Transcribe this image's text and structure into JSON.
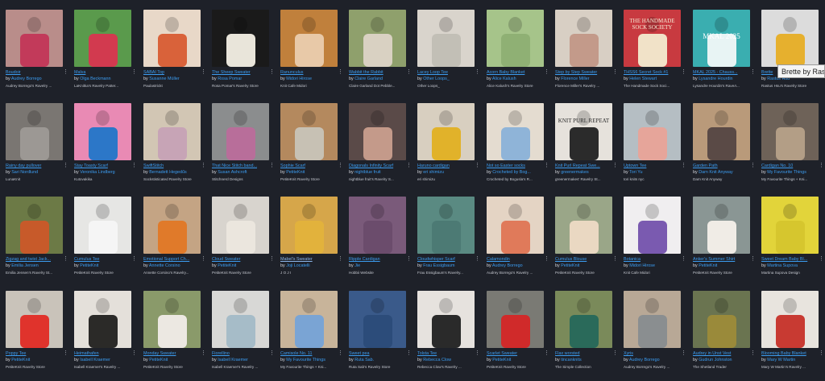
{
  "more_glyph": "⋮",
  "by_prefix": "by",
  "tooltip": "Brette by Ras",
  "thumb_text": {
    "sock": "THE HANDMADE SOCK SOCIETY",
    "mkal": "MKAL 2025",
    "knitpurl": "KNIT PURL REPEAT"
  },
  "rows": [
    [
      {
        "title": "Boudoir",
        "designer": "Audrey Borrego",
        "source": "Audrey Borrego's Ravelry ...",
        "bg": "#b98d8a",
        "fg": "#c23a5a"
      },
      {
        "title": "Malva",
        "designer": "Olga Beckmann",
        "source": "LaKnitka's Ravelry Patter...",
        "bg": "#5a9a4c",
        "fg": "#d23a4f"
      },
      {
        "title": "SABAI Top",
        "designer": "Susanne Müller",
        "source": "Paulastrickt",
        "bg": "#e8d8c8",
        "fg": "#d9623a"
      },
      {
        "title": "The Sheep Sweater",
        "designer": "Rosa Pomar",
        "source": "Rosa Pomar's Ravelry Store",
        "bg": "#1a1a1a",
        "fg": "#e9e5da"
      },
      {
        "title": "Ranunculus",
        "designer": "Midori Hirose",
        "source": "Knit Cafe Midori",
        "bg": "#c0803c",
        "fg": "#e8c9a8"
      },
      {
        "title": "Wabbit the Rabbit",
        "designer": "Claire Garland",
        "source": "Claire Garland Dot Pebble...",
        "bg": "#8fa06c",
        "fg": "#d9d1c2"
      },
      {
        "title": "Lacey Loop Tee",
        "designer": "Other Loops_",
        "source": "Other Loops_",
        "bg": "#d9d4cc",
        "fg": "#c2bfb6"
      },
      {
        "title": "Acorn Baby Blanket",
        "designer": "Alice Kalush",
        "source": "Alice Kalush's Ravelry Store",
        "bg": "#a6c48a",
        "fg": "#8fb074"
      },
      {
        "title": "Step by Step Sweater",
        "designer": "Florence Miller",
        "source": "Florence Miller's Ravelry ...",
        "bg": "#d8cfc4",
        "fg": "#c39a8a"
      },
      {
        "title": "THSS6 Secret Sock #1",
        "designer": "Helen Stewart",
        "source": "The Handmade Sock Soci...",
        "bg": "#c83a40",
        "fg": "#f1e2c8"
      },
      {
        "title": "MKAL 2025 - Chauss...",
        "designer": "Lysandre Hourdin",
        "source": "Lysandre Hourdin's Raveл...",
        "bg": "#3aaeb0",
        "fg": "#e8f4f4"
      },
      {
        "title": "Brette",
        "designer": "Rastus Hsu",
        "source": "Rastus Hsu's Ravelry Store",
        "bg": "#dcdcdc",
        "fg": "#e6b02e"
      }
    ],
    [
      {
        "title": "Rainy day pullover",
        "designer": "Sari Nordlund",
        "source": "LunaKnit",
        "bg": "#7a7672",
        "fg": "#9c9894"
      },
      {
        "title": "Stay Toasty Scarf",
        "designer": "Veronika Lindberg",
        "source": "Kutovakika",
        "bg": "#e98ab4",
        "fg": "#2c77c8"
      },
      {
        "title": "SwiftStitch",
        "designer": "Bernadett Hegedűs",
        "source": "Sockstisticated Ravelry Store",
        "bg": "#d2c6b4",
        "fg": "#c7a4b6"
      },
      {
        "title": "That Nice Stitch band...",
        "designer": "Susan Ashcroft",
        "source": "Stitchnerd Designs",
        "bg": "#8b8d8e",
        "fg": "#b86e9a"
      },
      {
        "title": "Sophie Scarf",
        "designer": "PetiteKnit",
        "source": "PetiteKnit Ravelry Store",
        "bg": "#b4895e",
        "fg": "#c7c1b4"
      },
      {
        "title": "Diagonals Infinity Scarf",
        "designer": "nightblue fruit",
        "source": "nightblue fruit's Ravelry S...",
        "bg": "#5a4a48",
        "fg": "#c49a8a"
      },
      {
        "title": "Haruno cardigan",
        "designer": "eri shimizu",
        "source": "eri shimizu",
        "bg": "#d8cfc0",
        "fg": "#e1b22a"
      },
      {
        "title": "Not so Easter socks",
        "designer": "Crocheted by Bog...",
        "source": "Crocheted by Boguslа's R...",
        "bg": "#e4dcd0",
        "fg": "#8fb4d8"
      },
      {
        "title": "Knit Purl Repeat Swe...",
        "designer": "greenermakes",
        "source": "greenermakes' Ravelry St...",
        "bg": "#e6e2dc",
        "fg": "#2b2b2b"
      },
      {
        "title": "Uptown Tee",
        "designer": "Tori Yu",
        "source": "tori knits nyc",
        "bg": "#b5bec3",
        "fg": "#e6a59a"
      },
      {
        "title": "Garden Path",
        "designer": "Darn Knit Anyway",
        "source": "Darn Knit Anyway",
        "bg": "#b99a7a",
        "fg": "#5a4a46"
      },
      {
        "title": "Cardigan No. 10",
        "designer": "My Favourite Things",
        "source": "My Favourite Things + Kni...",
        "bg": "#6e6258",
        "fg": "#b39e86"
      }
    ],
    [
      {
        "title": "Zigzag and twist Jack...",
        "designer": "Emilia Jensen",
        "source": "Emilia Jensen's Ravelry St...",
        "bg": "#6c7a46",
        "fg": "#c75a2a"
      },
      {
        "title": "Cumulus Tee",
        "designer": "PetiteKnit",
        "source": "PetiteKnit Ravelry Store",
        "bg": "#e6e6e4",
        "fg": "#f5f5f5"
      },
      {
        "title": "Emotional Support Ch...",
        "designer": "Annette Corsino",
        "source": "Annette Corsino's Ravelry...",
        "bg": "#c4a484",
        "fg": "#e07a2a"
      },
      {
        "title": "Cloud Sweater",
        "designer": "PetiteKnit",
        "source": "PetiteKnit Ravelry Store",
        "bg": "#d8d4ce",
        "fg": "#ebe6de"
      },
      {
        "title": "Mabel's Sweater",
        "designer": "Joji Locatelli",
        "source": "J O J I",
        "bg": "#d6a64a",
        "fg": "#e2b23c",
        "visited": true
      },
      {
        "title": "Ripple Cardigan",
        "designer": "Jie",
        "source": "Hobbii Website",
        "bg": "#7a5a7a",
        "fg": "#6b4c6c"
      },
      {
        "title": "Cloudwhisper Scarf",
        "designer": "Frau Essigbaum",
        "source": "Frau Essigbaum's Ravelry...",
        "bg": "#5a8a82",
        "fg": "#4c7a74"
      },
      {
        "title": "Calamondin",
        "designer": "Audrey Borrego",
        "source": "Audrey Borrego's Ravelry ...",
        "bg": "#e4d4c4",
        "fg": "#e07a5a"
      },
      {
        "title": "Cumulus Blouse",
        "designer": "PetiteKnit",
        "source": "PetiteKnit Ravelry Store",
        "bg": "#9aa688",
        "fg": "#ead8c2"
      },
      {
        "title": "Botanica",
        "designer": "Midori Hirose",
        "source": "Knit Cafe Midori",
        "bg": "#f0eef0",
        "fg": "#7a5ab0"
      },
      {
        "title": "Anker's Summer Shirt",
        "designer": "PetiteKnit",
        "source": "PetiteKnit Ravelry Store",
        "bg": "#8a9694",
        "fg": "#f0ece6"
      },
      {
        "title": "Sweet Dream Baby Bl...",
        "designer": "Martina Supova",
        "source": "Martina Supova Design",
        "bg": "#e2d43a",
        "fg": "#d6c62e"
      }
    ],
    [
      {
        "title": "Poppy Tee",
        "designer": "PetiteKnit",
        "source": "PetiteKnit Ravelry Store",
        "bg": "#c9c3ba",
        "fg": "#e0332c"
      },
      {
        "title": "Heimathafen",
        "designer": "Isabell Kraemer",
        "source": "Isabell Kraemer's Ravelry ...",
        "bg": "#e4e0da",
        "fg": "#2b2a28"
      },
      {
        "title": "Monday Sweater",
        "designer": "PetiteKnit",
        "source": "PetiteKnit Ravelry Store",
        "bg": "#8a9a6a",
        "fg": "#ece8e2"
      },
      {
        "title": "Fiorellino",
        "designer": "Isabell Kraemer",
        "source": "Isabell Kraemer's Ravelry ...",
        "bg": "#d8d8d6",
        "fg": "#a6bcc8"
      },
      {
        "title": "Camisole No. 11",
        "designer": "My Favourite Things",
        "source": "My Favourite Things + Kni...",
        "bg": "#c8b49a",
        "fg": "#7aa4d4"
      },
      {
        "title": "Sweet pea",
        "designer": "Ruta Sab.",
        "source": "Ruta Sab's Ravelry Store",
        "bg": "#3a5a8a",
        "fg": "#2c4c7a"
      },
      {
        "title": "Tolsta Tee",
        "designer": "Rebecca Clow",
        "source": "Rebecca Clow's Ravelry ...",
        "bg": "#e6e2de",
        "fg": "#2a2a2a"
      },
      {
        "title": "Scarlet Sweater",
        "designer": "PetiteKnit",
        "source": "PetiteKnit Ravelry Store",
        "bg": "#7a7a74",
        "fg": "#d02a2a"
      },
      {
        "title": "Flax worsted",
        "designer": "tincanknits",
        "source": "The Simple Collection",
        "bg": "#7a8a5a",
        "fg": "#2a6a5a"
      },
      {
        "title": "Xyris",
        "designer": "Audrey Borrego",
        "source": "Audrey Borrego's Ravelry ...",
        "bg": "#b8a896",
        "fg": "#8a8e90"
      },
      {
        "title": "Audrey in Unst Vest",
        "designer": "Gudrun Johnston",
        "source": "The Shetland Trader",
        "bg": "#6a7450",
        "fg": "#9a8a3a"
      },
      {
        "title": "Blooming Baby Blanket",
        "designer": "Mary W Martin",
        "source": "Mary W Martin's Ravelry ...",
        "bg": "#e8e4de",
        "fg": "#c83a32"
      }
    ]
  ]
}
